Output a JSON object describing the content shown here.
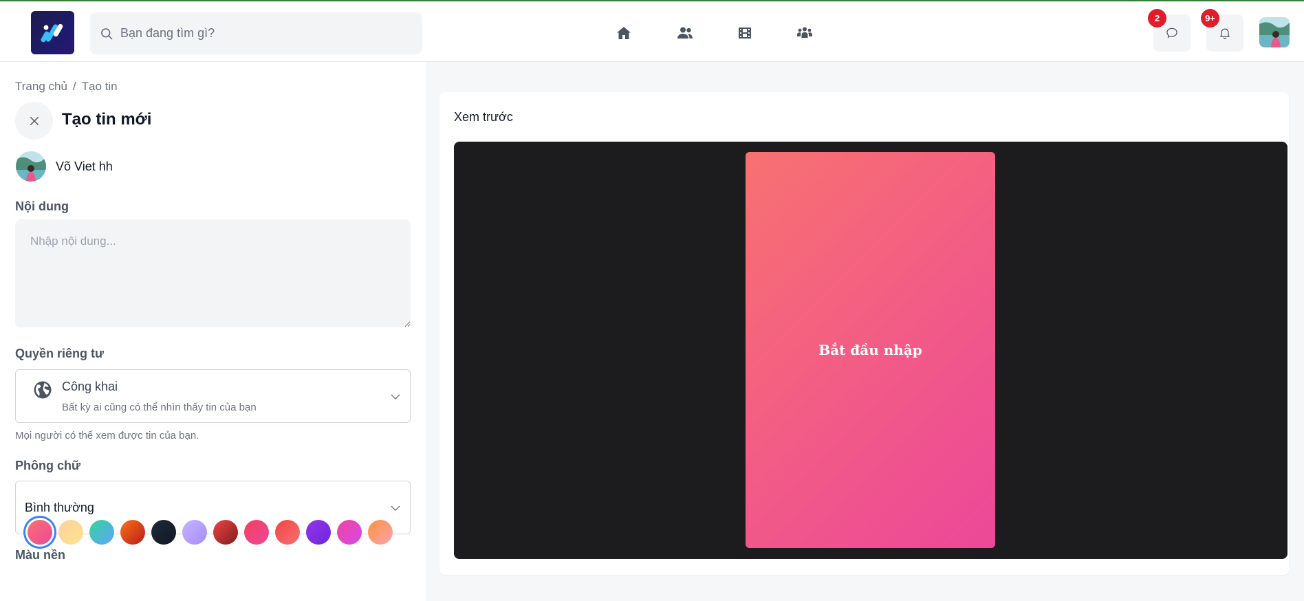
{
  "header": {
    "search_placeholder": "Bạn đang tìm gì?",
    "nav": [
      "home-icon",
      "friends-icon",
      "video-icon",
      "groups-icon"
    ],
    "messages_badge": "2",
    "notifications_badge": "9+"
  },
  "breadcrumb": {
    "home": "Trang chủ",
    "separator": "/",
    "current": "Tạo tin"
  },
  "page": {
    "title": "Tạo tin mới"
  },
  "user": {
    "name": "Võ Viet hh"
  },
  "form": {
    "content_label": "Nội dung",
    "content_placeholder": "Nhập nội dung...",
    "privacy_label": "Quyền riêng tư",
    "privacy_value": "Công khai",
    "privacy_desc": "Bất kỳ ai cũng có thể nhìn thấy tin của bạn",
    "privacy_hint": "Mọi người có thể xem được tin của bạn.",
    "font_label": "Phông chữ",
    "font_value": "Bình thường",
    "background_label": "Màu nền",
    "background_colors": [
      [
        "#f87171",
        "#ec4899"
      ],
      [
        "#fbcfa0",
        "#fde68a"
      ],
      [
        "#34d399",
        "#60a5fa"
      ],
      [
        "#f97316",
        "#b91c1c"
      ],
      [
        "#1f2937",
        "#111827"
      ],
      [
        "#c4b5fd",
        "#a78bfa"
      ],
      [
        "#ef4444",
        "#7f1d1d"
      ],
      [
        "#f43f5e",
        "#ec4899"
      ],
      [
        "#ef4444",
        "#f87171"
      ],
      [
        "#9333ea",
        "#6d28d9"
      ],
      [
        "#ec4899",
        "#d946ef"
      ],
      [
        "#fb923c",
        "#fda4af"
      ]
    ],
    "selected_color_index": 0
  },
  "preview": {
    "title": "Xem trước",
    "placeholder_text": "Bắt đầu nhập"
  }
}
